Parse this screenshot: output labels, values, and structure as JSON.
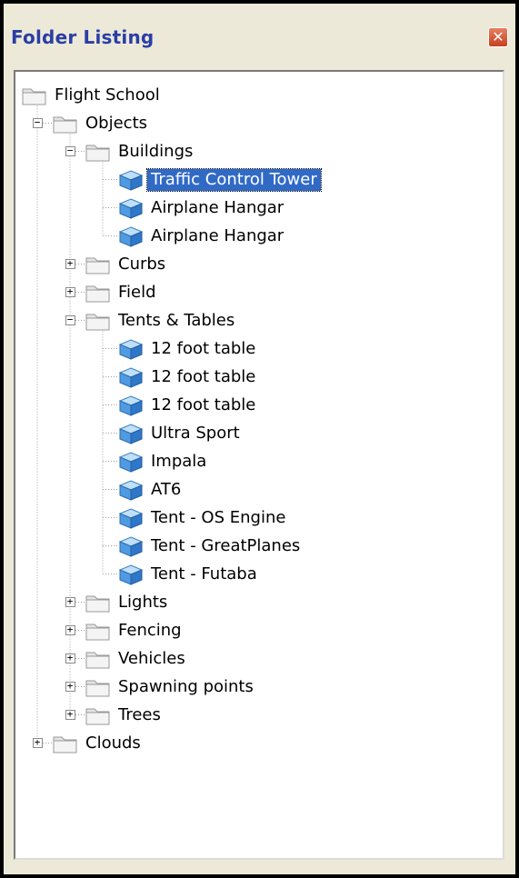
{
  "window": {
    "title": "Folder Listing",
    "close_glyph": "✕"
  },
  "tree": [
    {
      "label": "Flight School",
      "type": "folder",
      "level": 0,
      "expander": "none"
    },
    {
      "label": "Objects",
      "type": "folder",
      "level": 1,
      "expander": "−"
    },
    {
      "label": "Buildings",
      "type": "folder",
      "level": 2,
      "expander": "−"
    },
    {
      "label": "Traffic Control Tower",
      "type": "object",
      "level": 3,
      "selected": true
    },
    {
      "label": "Airplane Hangar",
      "type": "object",
      "level": 3
    },
    {
      "label": "Airplane Hangar",
      "type": "object",
      "level": 3
    },
    {
      "label": "Curbs",
      "type": "folder",
      "level": 2,
      "expander": "+"
    },
    {
      "label": "Field",
      "type": "folder",
      "level": 2,
      "expander": "+"
    },
    {
      "label": "Tents & Tables",
      "type": "folder",
      "level": 2,
      "expander": "−"
    },
    {
      "label": "12 foot table",
      "type": "object",
      "level": 3
    },
    {
      "label": "12 foot table",
      "type": "object",
      "level": 3
    },
    {
      "label": "12 foot table",
      "type": "object",
      "level": 3
    },
    {
      "label": "Ultra Sport",
      "type": "object",
      "level": 3
    },
    {
      "label": "Impala",
      "type": "object",
      "level": 3
    },
    {
      "label": "AT6",
      "type": "object",
      "level": 3
    },
    {
      "label": "Tent - OS Engine",
      "type": "object",
      "level": 3
    },
    {
      "label": "Tent - GreatPlanes",
      "type": "object",
      "level": 3
    },
    {
      "label": "Tent - Futaba",
      "type": "object",
      "level": 3
    },
    {
      "label": "Lights",
      "type": "folder",
      "level": 2,
      "expander": "+"
    },
    {
      "label": "Fencing",
      "type": "folder",
      "level": 2,
      "expander": "+"
    },
    {
      "label": "Vehicles",
      "type": "folder",
      "level": 2,
      "expander": "+"
    },
    {
      "label": "Spawning points",
      "type": "folder",
      "level": 2,
      "expander": "+"
    },
    {
      "label": "Trees",
      "type": "folder",
      "level": 2,
      "expander": "+"
    },
    {
      "label": "Clouds",
      "type": "folder",
      "level": 1,
      "expander": "+"
    }
  ],
  "icons": {
    "folder": "folder-icon",
    "object": "cube-icon"
  },
  "colors": {
    "title_text": "#2a3ea6",
    "selection": "#316ac5",
    "close_button": "#d0552f"
  }
}
